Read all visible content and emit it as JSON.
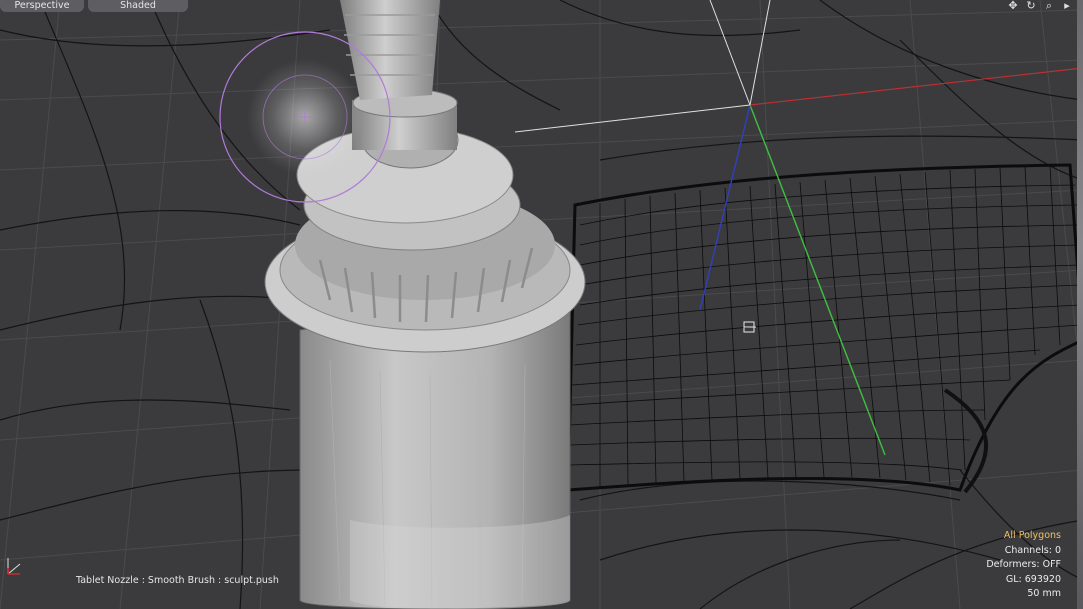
{
  "viewport": {
    "view_mode": "Perspective",
    "shading_mode": "Shaded",
    "nav_icons": [
      "move-icon",
      "rotate-icon",
      "zoom-icon",
      "more-arrow-icon"
    ]
  },
  "status_line": "Tablet Nozzle : Smooth Brush : sculpt.push",
  "stats": {
    "selection_mode": "All Polygons",
    "channels": "Channels: 0",
    "deformers": "Deformers: OFF",
    "gl_count": "GL: 693920",
    "scale": "50 mm"
  },
  "colors": {
    "background": "#3b3b3d",
    "grid": "#4a4a4d",
    "x_axis": "#c03030",
    "y_axis": "#40c040",
    "z_axis": "#3040c0",
    "brush_ring": "#b07ad8",
    "highlight_text": "#f0c060"
  }
}
